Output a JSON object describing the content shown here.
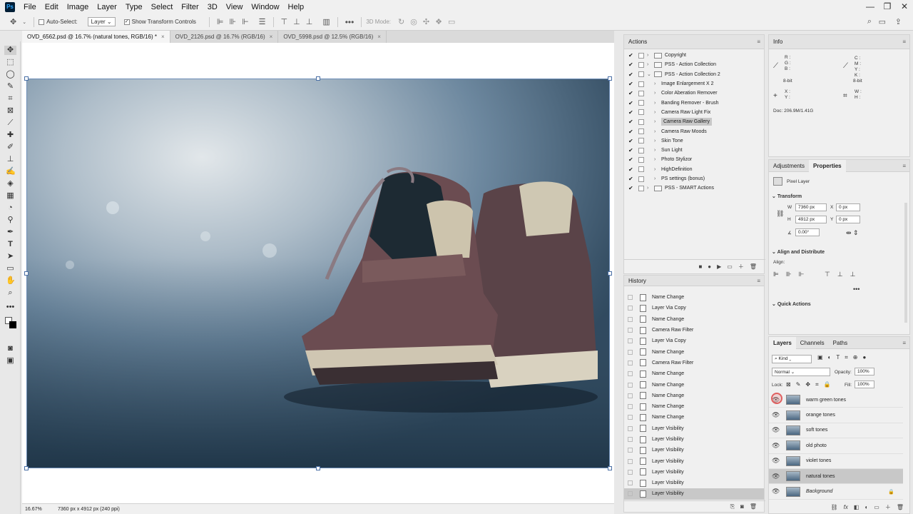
{
  "menubar": {
    "logo": "Ps",
    "items": [
      "File",
      "Edit",
      "Image",
      "Layer",
      "Type",
      "Select",
      "Filter",
      "3D",
      "View",
      "Window",
      "Help"
    ],
    "window_buttons": [
      "—",
      "❐",
      "✕"
    ]
  },
  "optionsbar": {
    "auto_select_label": "Auto-Select:",
    "auto_select_value": "Layer",
    "show_transform_label": "Show Transform Controls",
    "mode_3d_label": "3D Mode:"
  },
  "tabs": [
    {
      "label": "OVD_6562.psd @ 16.7% (natural tones, RGB/16) *",
      "active": true
    },
    {
      "label": "OVD_2126.psd @ 16.7% (RGB/16)",
      "active": false
    },
    {
      "label": "OVD_5998.psd @ 12.5% (RGB/16)",
      "active": false
    }
  ],
  "statusbar": {
    "zoom": "16.67%",
    "info": "7360 px x 4912 px (240 ppi)"
  },
  "actions": {
    "title": "Actions",
    "items": [
      {
        "label": "Copyright",
        "check": "✔",
        "folder": true,
        "indent": 0,
        "chevron": "›"
      },
      {
        "label": "PSS - Action Collection",
        "check": "✔",
        "folder": true,
        "indent": 0,
        "chevron": "›"
      },
      {
        "label": "PSS - Action Collection 2",
        "check": "✔",
        "folder": true,
        "indent": 0,
        "chevron": "⌄"
      },
      {
        "label": "Image Enlargement X 2",
        "check": "✔",
        "folder": false,
        "indent": 1,
        "chevron": "›"
      },
      {
        "label": "Color Aberation Remover",
        "check": "✔",
        "folder": false,
        "indent": 1,
        "chevron": "›"
      },
      {
        "label": "Banding Remover - Brush",
        "check": "✔",
        "folder": false,
        "indent": 1,
        "chevron": "›"
      },
      {
        "label": "Camera Raw Light Fix",
        "check": "✔",
        "folder": false,
        "indent": 1,
        "chevron": "›"
      },
      {
        "label": "Camera Raw Gallery",
        "check": "✔",
        "folder": false,
        "indent": 1,
        "chevron": "›",
        "highlight": true
      },
      {
        "label": "Camera Raw Moods",
        "check": "✔",
        "folder": false,
        "indent": 1,
        "chevron": "›"
      },
      {
        "label": "Skin Tone",
        "check": "✔",
        "folder": false,
        "indent": 1,
        "chevron": "›"
      },
      {
        "label": "Sun Light",
        "check": "✔",
        "folder": false,
        "indent": 1,
        "chevron": "›"
      },
      {
        "label": "Photo Stylizor",
        "check": "✔",
        "folder": false,
        "indent": 1,
        "chevron": "›"
      },
      {
        "label": "HighDefinition",
        "check": "✔",
        "folder": false,
        "indent": 1,
        "chevron": "›"
      },
      {
        "label": "PS settings (bonus)",
        "check": "✔",
        "folder": false,
        "indent": 1,
        "chevron": "›"
      },
      {
        "label": "PSS - SMART Actions",
        "check": "✔",
        "folder": true,
        "indent": 0,
        "chevron": "›"
      }
    ],
    "controls": [
      "■",
      "●",
      "▶"
    ]
  },
  "history": {
    "title": "History",
    "items": [
      "Name Change",
      "Layer Via Copy",
      "Name Change",
      "Camera Raw Filter",
      "Layer Via Copy",
      "Name Change",
      "Camera Raw Filter",
      "Name Change",
      "Name Change",
      "Name Change",
      "Name Change",
      "Name Change",
      "Layer Visibility",
      "Layer Visibility",
      "Layer Visibility",
      "Layer Visibility",
      "Layer Visibility",
      "Layer Visibility",
      "Layer Visibility"
    ]
  },
  "info": {
    "title": "Info",
    "left_channels": [
      "R :",
      "G :",
      "B :"
    ],
    "right_channels": [
      "C :",
      "M :",
      "Y :",
      "K :"
    ],
    "bit_left": "8-bit",
    "bit_right": "8-bit",
    "xy": [
      "X :",
      "Y :"
    ],
    "wh": [
      "W :",
      "H :"
    ],
    "doc": "Doc: 206.9M/1.41G"
  },
  "properties": {
    "tabs": [
      "Adjustments",
      "Properties"
    ],
    "type_label": "Pixel Layer",
    "transform_title": "Transform",
    "w_label": "W",
    "w_value": "7360 px",
    "h_label": "H",
    "h_value": "4912 px",
    "x_label": "X",
    "x_value": "0 px",
    "y_label": "Y",
    "y_value": "0 px",
    "angle_value": "0.00°",
    "align_title": "Align and Distribute",
    "align_label": "Align:",
    "more": "•••",
    "quick_title": "Quick Actions"
  },
  "layers": {
    "tabs": [
      "Layers",
      "Channels",
      "Paths"
    ],
    "kind_label": "Kind",
    "blend_mode": "Normal",
    "opacity_label": "Opacity:",
    "opacity_value": "100%",
    "lock_label": "Lock:",
    "fill_label": "Fill:",
    "fill_value": "100%",
    "items": [
      {
        "name": "warm green tones",
        "highlight": false,
        "italic": false
      },
      {
        "name": "orange tones",
        "highlight": false,
        "italic": false
      },
      {
        "name": "soft tones",
        "highlight": false,
        "italic": false
      },
      {
        "name": "old photo",
        "highlight": false,
        "italic": false
      },
      {
        "name": "violet tones",
        "highlight": false,
        "italic": false
      },
      {
        "name": "natural tones",
        "highlight": true,
        "italic": false
      },
      {
        "name": "Background",
        "highlight": false,
        "italic": true
      }
    ],
    "footer_icons": [
      "⛓",
      "fx",
      "◧",
      "◐",
      "▭",
      "＋",
      "🗑"
    ]
  }
}
